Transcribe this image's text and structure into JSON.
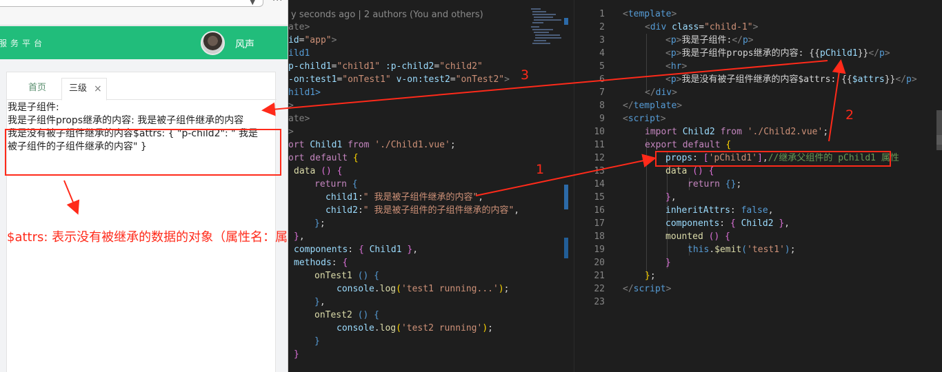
{
  "browser": {
    "brand": "服务平台",
    "username": "风声",
    "tabs": [
      {
        "label": "首页"
      },
      {
        "label": "三级",
        "close": "×"
      }
    ],
    "content": {
      "line1": "我是子组件:",
      "line2": "我是子组件props继承的内容: 我是被子组件继承的内容",
      "line3": "我是没有被子组件继承的内容$attrs: { \"p-child2\": \" 我是",
      "line4": "被子组件的子组件继承的内容\" }"
    },
    "annotation": "$attrs: 表示没有被继承的数据的对象（属性名：属性值)"
  },
  "mid_editor": {
    "blame": "y seconds ago | 2 authors (You and others)"
  },
  "right_editor": {
    "line_numbers": [
      "1",
      "2",
      "3",
      "4",
      "5",
      "6",
      "7",
      "8",
      "9",
      "10",
      "11",
      "12",
      "13",
      "14",
      "15",
      "16",
      "17",
      "18",
      "19",
      "20",
      "21",
      "22",
      "23"
    ]
  },
  "annotations": {
    "labels": [
      "1",
      "2",
      "3"
    ],
    "color": "#ff2a1a"
  },
  "colors": {
    "appbar": "#21bd7b",
    "editor_bg": "#1e1e1e",
    "highlight": "#ff2a1a"
  }
}
